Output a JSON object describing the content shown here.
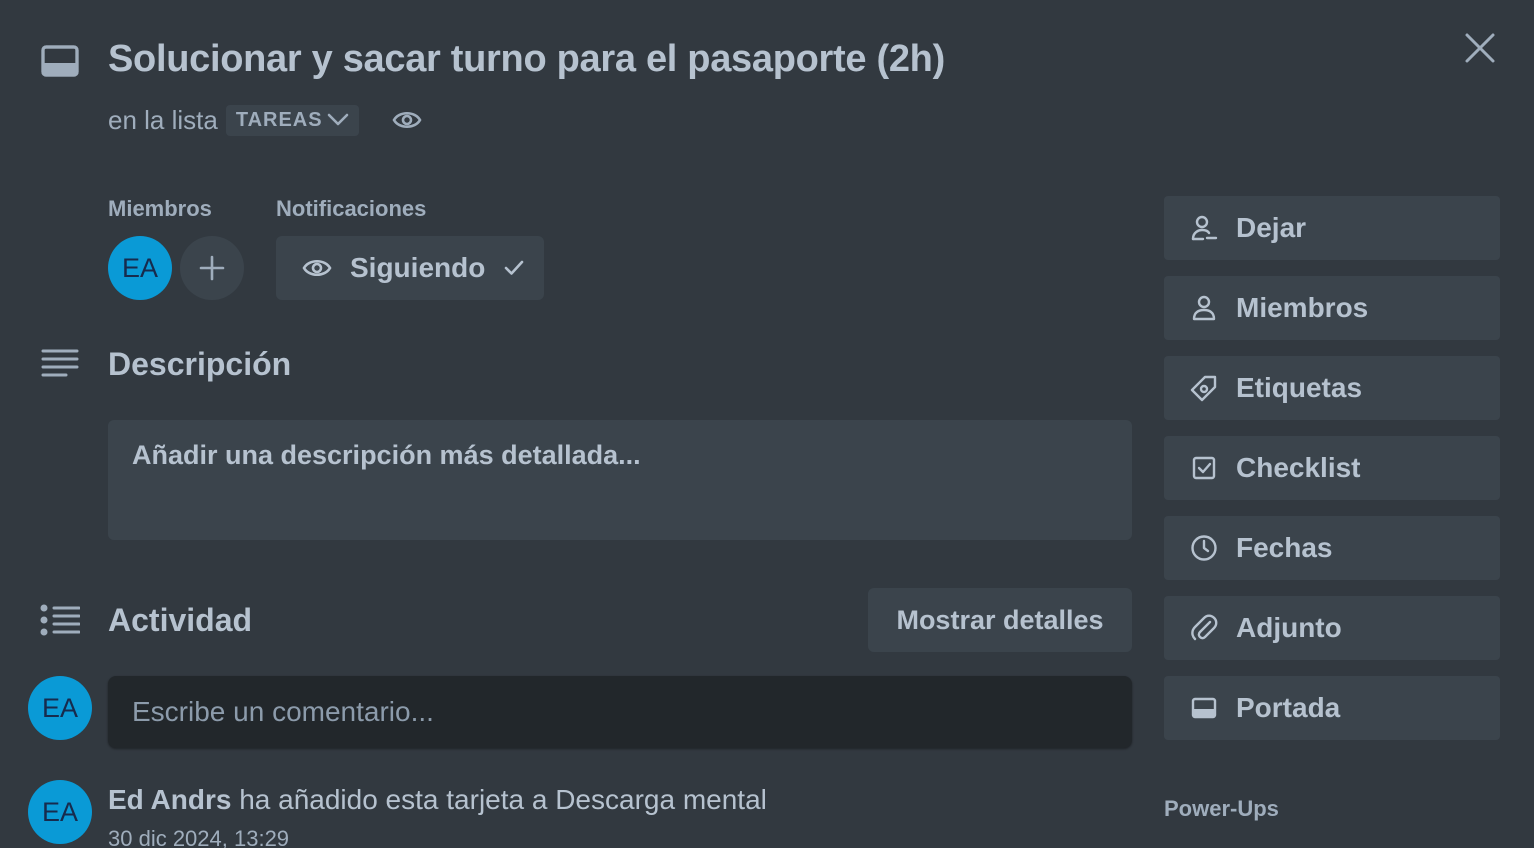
{
  "header": {
    "title": "Solucionar y sacar turno para el pasaporte (2h)",
    "list_prefix": "en la lista",
    "list_name": "TAREAS",
    "card_icon": "card-icon",
    "close_icon": "close-icon",
    "watch_icon": "eye-icon"
  },
  "members": {
    "label": "Miembros",
    "avatar_initials": "EA",
    "add_icon": "plus-icon"
  },
  "notifications": {
    "label": "Notificaciones",
    "button_label": "Siguiendo"
  },
  "description": {
    "heading": "Descripción",
    "placeholder": "Añadir una descripción más detallada..."
  },
  "activity": {
    "heading": "Actividad",
    "details_button": "Mostrar detalles",
    "comment_avatar": "EA",
    "comment_placeholder": "Escribe un comentario...",
    "entries": [
      {
        "avatar": "EA",
        "user": "Ed Andrs",
        "action": " ha añadido esta tarjeta a Descarga mental",
        "timestamp": "30 dic 2024, 13:29"
      }
    ]
  },
  "sidebar": {
    "buttons": [
      {
        "label": "Dejar",
        "icon": "leave-user-icon"
      },
      {
        "label": "Miembros",
        "icon": "user-icon"
      },
      {
        "label": "Etiquetas",
        "icon": "tag-icon"
      },
      {
        "label": "Checklist",
        "icon": "checkbox-icon"
      },
      {
        "label": "Fechas",
        "icon": "clock-icon"
      },
      {
        "label": "Adjunto",
        "icon": "paperclip-icon"
      },
      {
        "label": "Portada",
        "icon": "cover-icon"
      }
    ],
    "powerups_label": "Power-Ups"
  },
  "colors": {
    "background": "#323940",
    "button_bg": "#3b444c",
    "input_bg": "#22272b",
    "text": "#b6c2cf",
    "avatar": "#0a9ad6"
  }
}
